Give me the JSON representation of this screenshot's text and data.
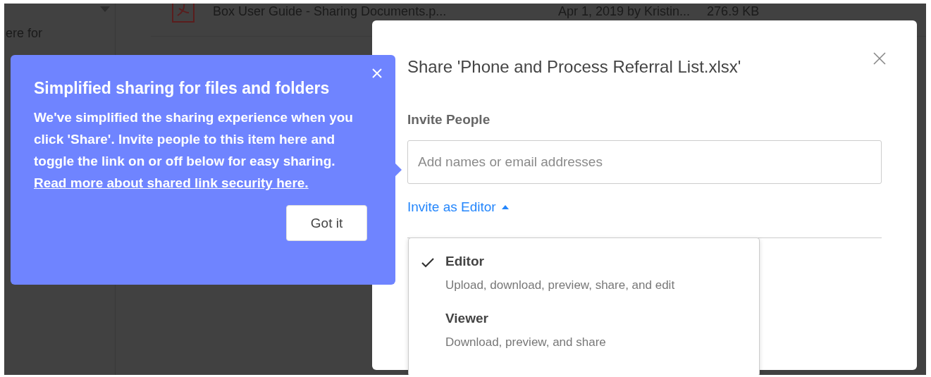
{
  "background": {
    "sidebar_text": "ere for",
    "files": [
      {
        "name": "Box User Guide - Sharing Documents.p...",
        "modified": "Apr 1, 2019 by Kristin...",
        "size": "276.9 KB"
      }
    ]
  },
  "tooltip": {
    "title": "Simplified sharing for files and folders",
    "body": "We've simplified the sharing experience when you click 'Share'. Invite people to this item here and toggle the link on or off below for easy sharing.",
    "link": "Read more about shared link security here.",
    "button": "Got it"
  },
  "dialog": {
    "title": "Share 'Phone and Process Referral List.xlsx'",
    "section": "Invite People",
    "invite_field": {
      "placeholder": "Add names or email addresses"
    },
    "role_toggle": {
      "label": "Invite as Editor",
      "expanded": true
    },
    "role_menu": [
      {
        "label": "Editor",
        "description": "Upload, download, preview, share, and edit",
        "selected": true
      },
      {
        "label": "Viewer",
        "description": "Download, preview, and share",
        "selected": false
      }
    ]
  }
}
